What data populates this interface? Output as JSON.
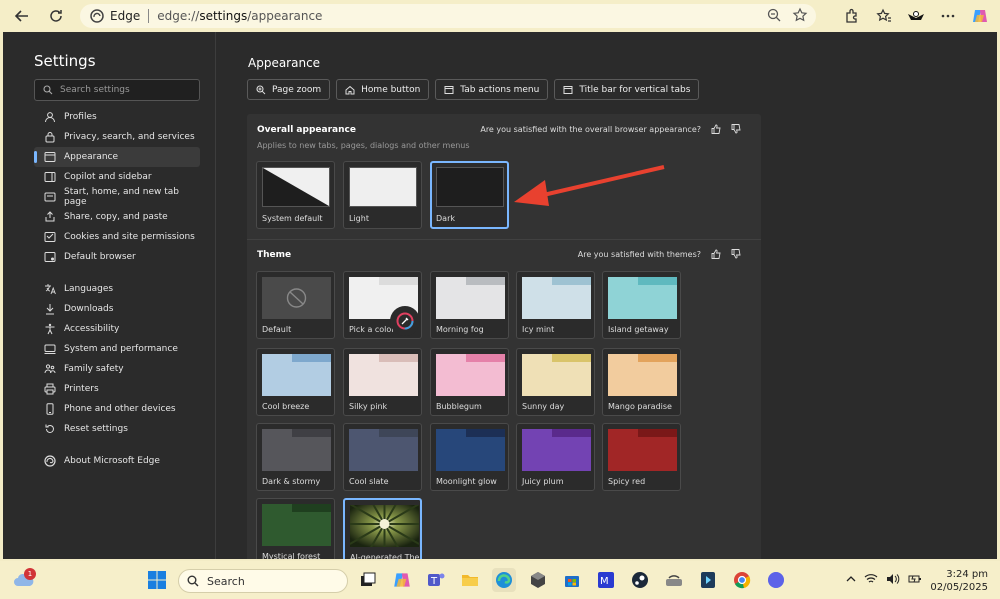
{
  "browser": {
    "brand": "Edge",
    "url_prefix": "edge://",
    "url_highlight": "settings",
    "url_suffix": "/appearance"
  },
  "sidebar": {
    "title": "Settings",
    "search_placeholder": "Search settings",
    "items": [
      {
        "label": "Profiles",
        "icon": "profile-icon"
      },
      {
        "label": "Privacy, search, and services",
        "icon": "lock-icon"
      },
      {
        "label": "Appearance",
        "icon": "appearance-icon",
        "active": true
      },
      {
        "label": "Copilot and sidebar",
        "icon": "sidebar-icon"
      },
      {
        "label": "Start, home, and new tab page",
        "icon": "home-icon"
      },
      {
        "label": "Share, copy, and paste",
        "icon": "share-icon"
      },
      {
        "label": "Cookies and site permissions",
        "icon": "cookies-icon"
      },
      {
        "label": "Default browser",
        "icon": "browser-icon"
      },
      {
        "label": "Languages",
        "icon": "languages-icon"
      },
      {
        "label": "Downloads",
        "icon": "download-icon"
      },
      {
        "label": "Accessibility",
        "icon": "accessibility-icon"
      },
      {
        "label": "System and performance",
        "icon": "system-icon"
      },
      {
        "label": "Family safety",
        "icon": "family-icon"
      },
      {
        "label": "Printers",
        "icon": "printer-icon"
      },
      {
        "label": "Phone and other devices",
        "icon": "phone-icon"
      },
      {
        "label": "Reset settings",
        "icon": "reset-icon"
      },
      {
        "label": "About Microsoft Edge",
        "icon": "edge-icon"
      }
    ]
  },
  "main": {
    "title": "Appearance",
    "chips": [
      "Page zoom",
      "Home button",
      "Tab actions menu",
      "Title bar for vertical tabs"
    ],
    "overall": {
      "title": "Overall appearance",
      "subtitle": "Applies to new tabs, pages, dialogs and other menus",
      "feedback": "Are you satisfied with the overall browser appearance?",
      "options": [
        "System default",
        "Light",
        "Dark"
      ],
      "selected": "Dark"
    },
    "theme": {
      "title": "Theme",
      "feedback": "Are you satisfied with themes?",
      "items": [
        {
          "label": "Default",
          "tab": "#4a4a4a",
          "body": "#4a4a4a"
        },
        {
          "label": "Pick a color",
          "tab": "#dcdcdc",
          "body": "#f0f0f0"
        },
        {
          "label": "Morning fog",
          "tab": "#b9bcc0",
          "body": "#e4e4e6"
        },
        {
          "label": "Icy mint",
          "tab": "#9ec2d2",
          "body": "#cfe0e8"
        },
        {
          "label": "Island getaway",
          "tab": "#5fb9bf",
          "body": "#8fd3d6"
        },
        {
          "label": "Cool breeze",
          "tab": "#7ea8cd",
          "body": "#b2cde3"
        },
        {
          "label": "Silky pink",
          "tab": "#d9bdb8",
          "body": "#f0e2df"
        },
        {
          "label": "Bubblegum",
          "tab": "#e581a9",
          "body": "#f3bcd2"
        },
        {
          "label": "Sunny day",
          "tab": "#d9c46a",
          "body": "#efe0b6"
        },
        {
          "label": "Mango paradise",
          "tab": "#e3a35c",
          "body": "#f2cc9e"
        },
        {
          "label": "Dark & stormy",
          "tab": "#3f3f44",
          "body": "#56565b"
        },
        {
          "label": "Cool slate",
          "tab": "#3e4658",
          "body": "#4d5670"
        },
        {
          "label": "Moonlight glow",
          "tab": "#1c2f55",
          "body": "#27477a"
        },
        {
          "label": "Juicy plum",
          "tab": "#5a2a8c",
          "body": "#7343b3"
        },
        {
          "label": "Spicy red",
          "tab": "#7a1818",
          "body": "#a12626"
        },
        {
          "label": "Mystical forest",
          "tab": "#1f3f1f",
          "body": "#2f5a2f"
        },
        {
          "label": "AI-generated Theme",
          "tab": "#3a4a2a",
          "body": "#6a7a3a",
          "selected": true
        }
      ]
    }
  },
  "taskbar": {
    "search_label": "Search",
    "notification_count": "1",
    "time": "3:24 pm",
    "date": "02/05/2025"
  },
  "colors": {
    "accent": "#7ab7ff",
    "arrow": "#e8412f"
  }
}
